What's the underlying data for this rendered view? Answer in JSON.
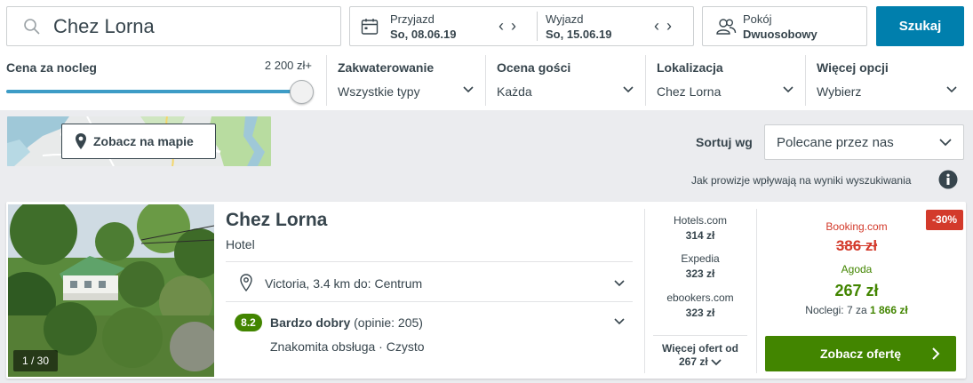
{
  "search": {
    "value": "Chez Lorna"
  },
  "dates": {
    "checkin_label": "Przyjazd",
    "checkin_value": "So, 08.06.19",
    "checkout_label": "Wyjazd",
    "checkout_value": "So, 15.06.19",
    "prev_arrow": "‹",
    "next_arrow": "›"
  },
  "rooms": {
    "label": "Pokój",
    "value": "Dwuosobowy"
  },
  "search_button": "Szukaj",
  "filters": {
    "price_title": "Cena za nocleg",
    "price_max": "2 200 zł+",
    "price_fraction": 1.0,
    "accommodation": {
      "title": "Zakwaterowanie",
      "value": "Wszystkie typy"
    },
    "guest_rating": {
      "title": "Ocena gości",
      "value": "Każda"
    },
    "location": {
      "title": "Lokalizacja",
      "value": "Chez Lorna"
    },
    "more": {
      "title": "Więcej opcji",
      "value": "Wybierz"
    }
  },
  "map_button": "Zobacz na mapie",
  "sort": {
    "label": "Sortuj wg",
    "value": "Polecane przez nas"
  },
  "commission_note": "Jak prowizje wpływają na wyniki wyszukiwania",
  "hotel": {
    "name": "Chez Lorna",
    "type": "Hotel",
    "photo_counter": "1 / 30",
    "location": "Victoria, 3.4 km do: Centrum",
    "rating_score": "8.2",
    "rating_label": "Bardzo dobry",
    "rating_count": "(opinie: 205)",
    "highlights": "Znakomita obsługa · Czysto",
    "offers": [
      {
        "source": "Hotels.com",
        "price": "314 zł"
      },
      {
        "source": "Expedia",
        "price": "323 zł"
      },
      {
        "source": "ebookers.com",
        "price": "323 zł"
      }
    ],
    "more_offers_label": "Więcej ofert od",
    "more_offers_price": "267 zł",
    "discount": "-30%",
    "strike_source": "Booking.com",
    "strike_price": "386 zł",
    "best_source": "Agoda",
    "best_price": "267 zł",
    "nights_text": "Noclegi: 7 za",
    "nights_total": "1 866 zł",
    "deal_button": "Zobacz ofertę"
  },
  "colors": {
    "primary_blue": "#007fad",
    "deal_green": "#428500",
    "strike_red": "#d33a2b",
    "text": "#37454d"
  }
}
